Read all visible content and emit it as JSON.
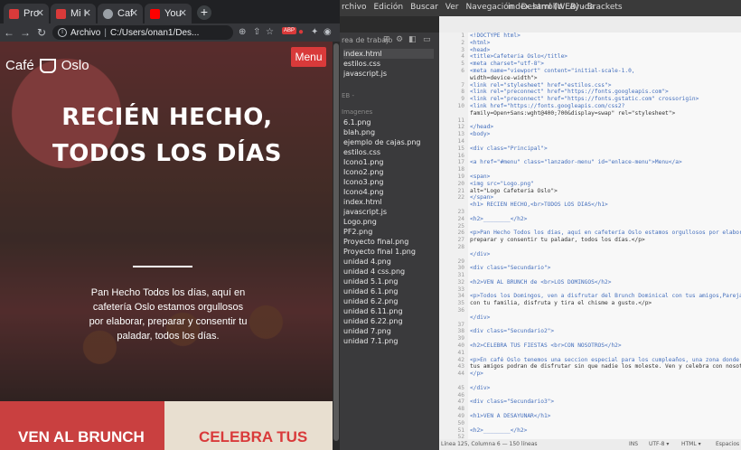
{
  "chrome": {
    "tabs": [
      {
        "label": "Pro",
        "favicon_color": "#d93a3a"
      },
      {
        "label": "Mi I",
        "favicon_color": "#d93a3a"
      },
      {
        "label": "Caf",
        "favicon_color": "#9aa0a6"
      },
      {
        "label": "You",
        "favicon_color": "#ff0000"
      }
    ],
    "new_tab": "+",
    "address_prefix": "Archivo",
    "address_url": "C:/Users/onan1/Des...",
    "back": "←",
    "forward": "→",
    "reload": "↻",
    "ext_abp": "ABP"
  },
  "site": {
    "logo_left": "Café",
    "logo_right": "Oslo",
    "menu": "Menu",
    "hero_title": "RECIÉN HECHO, TODOS LOS DÍAS",
    "intro": "Pan Hecho Todos los días, aquí en cafetería Oslo estamos orgullosos por elaborar, preparar y consentir tu paladar, todos los días.",
    "section1_title": "VEN AL BRUNCH",
    "section2_title": "CELEBRA TUS",
    "colors": {
      "accent": "#d93a3a",
      "section2_bg": "#e8dfd0"
    }
  },
  "brackets": {
    "menu": [
      "rchivo",
      "Edición",
      "Buscar",
      "Ver",
      "Navegación",
      "Desarrollo",
      "Ayuda"
    ],
    "window_title": "index.html (WEB) - Brackets",
    "working_files_head": "rea de trabajo",
    "working_files": [
      {
        "name": "index.html",
        "ext": ""
      },
      {
        "name": "estilos.css",
        "ext": ""
      },
      {
        "name": "javascript.js",
        "ext": ""
      }
    ],
    "project_head": "EB -",
    "folder_head": "Imagenes",
    "files": [
      "6.1.png",
      "blah.png",
      "ejemplo de cajas.png",
      "estilos.css",
      "Icono1.png",
      "Icono2.png",
      "Icono3.png",
      "Icono4.png",
      "index.html",
      "javascript.js",
      "Logo.png",
      "PF2.png",
      "Proyecto final.png",
      "Proyecto final 1.png",
      "unidad 4.png",
      "unidad 4 css.png",
      "unidad 5.1.png",
      "unidad 6.1.png",
      "unidad 6.2.png",
      "unidad 6.11.png",
      "unidad 6.22.png",
      "unidad 7.png",
      "unidad 7.1.png"
    ],
    "code_lines": [
      "<!DOCTYPE html>",
      "<html>",
      "<head>",
      "<title>Cafeteria Oslo</title>",
      "<meta charset=\"utf-8\">",
      "<meta name=\"viewport\" content=\"initial-scale-1.0,",
      "width=device-width\">",
      "<link rel=\"stylesheet\" href=\"estilos.css\">",
      "<link rel=\"preconnect\" href=\"https://fonts.googleapis.com\">",
      "<link rel=\"preconnect\" href=\"https://fonts.gstatic.com\" crossorigin>",
      "<link href=\"https://fonts.googleapis.com/css2?",
      "family=Open+Sans:wght@400;700&display=swap\" rel=\"stylesheet\">",
      "",
      "</head>",
      "<body>",
      "",
      "<div class=\"Principal\">",
      "",
      "<a href=\"#menu\" class=\"lanzador-menu\" id=\"enlace-menu\">Menu</a>",
      "",
      "<span>",
      "<img src=\"Logo.png\"",
      "alt=\"Logo Cafeteria Oslo\">",
      "</span>",
      "<h1> RECIÉN HECHO,<br>TODOS LOS DÍAS</h1>",
      "",
      "<h2>________</h2>",
      "",
      "<p>Pan Hecho Todos los días, aquí en cafetería Oslo estamos orgullosos por elaborar,",
      "preparar y consentir tu paladar, todos los días.</p>",
      "",
      "</div>",
      "",
      "<div class=\"Secundario\">",
      "",
      "<h2>VEN AL BRUNCH de <br>LOS DOMINGOS</h2>",
      "",
      "<p>Todos los Domingos, ven a disfrutar del Brunch Dominical con tus amigos,Pareja , o",
      "con tu familia, disfruta y tira el chisme a gusto.</p>",
      "",
      "</div>",
      "",
      "<div class=\"Secundario2\">",
      "",
      "<h2>CELEBRA TUS FIESTAS <br>CON NOSOTROS</h2>",
      "",
      "<p>En café Oslo tenemos una seccion especial para los cumpleaños, una zona donde tú y",
      "tus amigos podran de disfrutar sin que nadie los moleste. Ven y celebra con nosotros.",
      "</p>",
      "",
      "</div>",
      "",
      "<div class=\"Secundario3\">",
      "",
      "<h1>VEN A DESAYUNAR</h1>",
      "",
      "<h2>________</h2>",
      "",
      "<p>Tenemos Los mejores desayunos de la zona, calidad y precio. No te vas a arrepentir</p>"
    ],
    "line_numbers": [
      "1",
      "2",
      "3",
      "4",
      "5",
      "6",
      "",
      "7",
      "8",
      "9",
      "10",
      "",
      "11",
      "12",
      "13",
      "14",
      "15",
      "16",
      "17",
      "18",
      "19",
      "20",
      "21",
      "22",
      "",
      "23",
      "24",
      "25",
      "26",
      "27",
      "28",
      "",
      "29",
      "30",
      "31",
      "32",
      "33",
      "34",
      "35",
      "36",
      "",
      "37",
      "38",
      "39",
      "40",
      "41",
      "42",
      "43",
      "44",
      "",
      "45",
      "46",
      "47",
      "48",
      "49",
      "50",
      "51",
      "52",
      "53",
      "54",
      "55"
    ],
    "status_left": "Línea 125, Columna 6 — 150 líneas",
    "status_ins": "INS",
    "status_enc": "UTF-8 ▾",
    "status_lang": "HTML ▾",
    "status_spaces": "Espacios"
  }
}
